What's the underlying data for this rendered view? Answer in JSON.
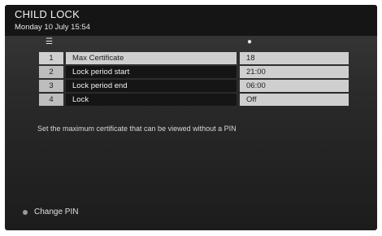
{
  "header": {
    "title": "CHILD LOCK",
    "datetime": "Monday 10 July 15:54"
  },
  "table": {
    "rows": [
      {
        "num": "1",
        "name": "Max Certificate",
        "value": "18",
        "selected": false
      },
      {
        "num": "2",
        "name": "Lock period start",
        "value": "21:00",
        "selected": true
      },
      {
        "num": "3",
        "name": "Lock period end",
        "value": "06:00",
        "selected": true
      },
      {
        "num": "4",
        "name": "Lock",
        "value": "Off",
        "selected": true
      }
    ]
  },
  "help_text": "Set the maximum certificate that can be viewed without a PIN",
  "footer": {
    "action_label": "Change PIN"
  },
  "icons": {
    "left_column": "menu-lines-icon",
    "right_column": "lock-icon"
  }
}
